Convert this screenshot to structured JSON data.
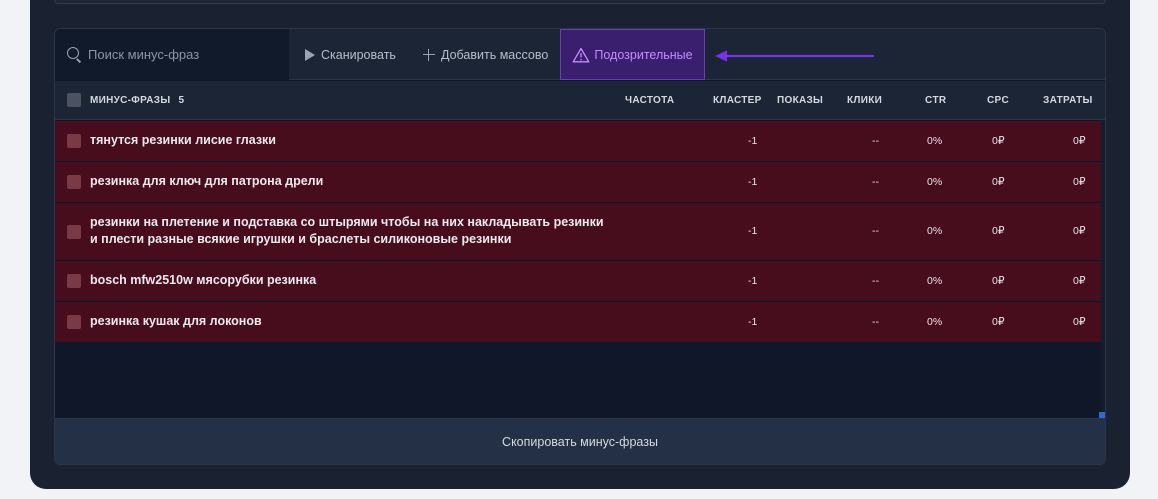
{
  "toolbar": {
    "search_placeholder": "Поиск минус-фраз",
    "scan_label": "Сканировать",
    "bulk_add_label": "Добавить массово",
    "suspicious_label": "Подозрительные"
  },
  "table": {
    "header_phrases": "МИНУС-ФРАЗЫ",
    "phrase_count": "5",
    "columns": [
      "ЧАСТОТА",
      "КЛАСТЕР",
      "ПОКАЗЫ",
      "КЛИКИ",
      "CTR",
      "CPC",
      "ЗАТРАТЫ"
    ],
    "rows": [
      {
        "phrase": "тянутся резинки лисие глазки",
        "cluster": "-1",
        "clicks": "--",
        "ctr": "0%",
        "cpc": "0₽",
        "cost": "0₽"
      },
      {
        "phrase": "резинка для ключ для патрона дрели",
        "cluster": "-1",
        "clicks": "--",
        "ctr": "0%",
        "cpc": "0₽",
        "cost": "0₽"
      },
      {
        "phrase": "резинки на плетение и подставка со штырями чтобы на них накладывать резинки и плести разные всякие игрушки и браслеты силиконовые резинки",
        "cluster": "-1",
        "clicks": "--",
        "ctr": "0%",
        "cpc": "0₽",
        "cost": "0₽"
      },
      {
        "phrase": "bosch mfw2510w мясорубки резинка",
        "cluster": "-1",
        "clicks": "--",
        "ctr": "0%",
        "cpc": "0₽",
        "cost": "0₽"
      },
      {
        "phrase": "резинка кушак для локонов",
        "cluster": "-1",
        "clicks": "--",
        "ctr": "0%",
        "cpc": "0₽",
        "cost": "0₽"
      }
    ]
  },
  "footer": {
    "copy_label": "Скопировать минус-фразы"
  },
  "colors": {
    "accent": "#6b3fb3",
    "suspicious_text": "#c38cff",
    "row_highlight": "#470d1c",
    "arrow": "#7a2ef0"
  }
}
